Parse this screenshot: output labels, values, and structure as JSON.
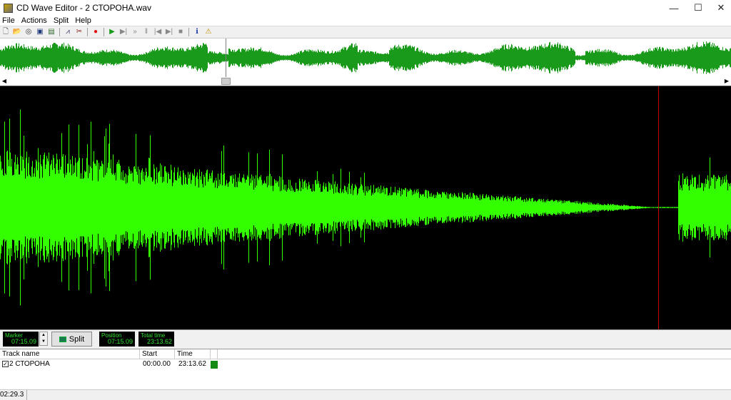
{
  "window": {
    "title": "CD Wave Editor - 2 СТОРОНА.wav",
    "minimize_glyph": "—",
    "maximize_glyph": "☐",
    "close_glyph": "✕"
  },
  "menu": {
    "items": [
      {
        "label": "File"
      },
      {
        "label": "Actions"
      },
      {
        "label": "Split"
      },
      {
        "label": "Help"
      }
    ]
  },
  "toolbar": {
    "buttons": [
      {
        "icon": "new-file-icon",
        "glyph": "🗋",
        "color": "#555555"
      },
      {
        "icon": "open-folder-icon",
        "glyph": "📂",
        "color": "#b08a00"
      },
      {
        "icon": "cd-icon",
        "glyph": "◎",
        "color": "#333333"
      },
      {
        "icon": "save-icon",
        "glyph": "▣",
        "color": "#1f3c7a"
      },
      {
        "icon": "save-as-icon",
        "glyph": "▤",
        "color": "#2a6a2a"
      },
      {
        "icon": "auto-split-icon",
        "glyph": "⩘",
        "color": "#333366"
      },
      {
        "icon": "split-tools-icon",
        "glyph": "✂",
        "color": "#8a2020"
      },
      {
        "icon": "record-icon",
        "glyph": "●",
        "color": "#e01010"
      },
      {
        "icon": "play-icon",
        "glyph": "▶",
        "color": "#1a9a1a"
      },
      {
        "icon": "play-next-icon",
        "glyph": "▶|",
        "color": "#888888"
      },
      {
        "icon": "fast-forward-icon",
        "glyph": "»",
        "color": "#888888"
      },
      {
        "icon": "pause-icon",
        "glyph": "‖",
        "color": "#888888"
      },
      {
        "icon": "previous-icon",
        "glyph": "|◀",
        "color": "#888888"
      },
      {
        "icon": "next-icon",
        "glyph": "▶|",
        "color": "#888888"
      },
      {
        "icon": "stop-icon",
        "glyph": "■",
        "color": "#888888"
      },
      {
        "icon": "info-icon",
        "glyph": "ℹ",
        "color": "#1c3fa8"
      },
      {
        "icon": "warning-icon",
        "glyph": "⚠",
        "color": "#c09000"
      }
    ]
  },
  "overview": {
    "wave_color": "#1a9a1a",
    "cursor_fraction": 0.309
  },
  "main_wave": {
    "wave_color": "#33ff00",
    "marker_color": "#c00000"
  },
  "controls": {
    "marker_label": "Marker",
    "marker_value": "07:15.09",
    "split_label": "Split",
    "position_label": "Position",
    "position_value": "07:15.09",
    "total_label": "Total time",
    "total_value": "23:13.62"
  },
  "tracklist": {
    "columns": [
      {
        "label": "Track name"
      },
      {
        "label": "Start"
      },
      {
        "label": "Time"
      },
      {
        "label": ""
      }
    ],
    "rows": [
      {
        "checked": true,
        "name": "2 СТОРОНА",
        "start": "00:00.00",
        "time": "23:13.62",
        "color": "#138a13"
      }
    ]
  },
  "status": {
    "text": "02:29.3"
  }
}
